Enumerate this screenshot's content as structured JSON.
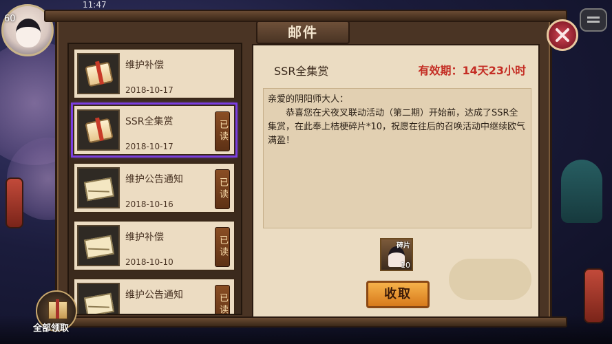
{
  "status_bar": {
    "time": "11:47"
  },
  "player": {
    "level": "60"
  },
  "window": {
    "title": "邮件"
  },
  "mail_list": [
    {
      "title": "维护补偿",
      "date": "2018-10-17",
      "icon": "gift-icon",
      "read_label": "",
      "selected": false
    },
    {
      "title": "SSR全集赏",
      "date": "2018-10-17",
      "icon": "gift-icon",
      "read_label": "已读",
      "selected": true
    },
    {
      "title": "维护公告通知",
      "date": "2018-10-16",
      "icon": "envelope-icon",
      "read_label": "已读",
      "selected": false
    },
    {
      "title": "维护补偿",
      "date": "2018-10-10",
      "icon": "envelope-icon",
      "read_label": "已读",
      "selected": false
    },
    {
      "title": "维护公告通知",
      "date": "",
      "icon": "envelope-icon",
      "read_label": "已读",
      "selected": false
    }
  ],
  "detail": {
    "title": "SSR全集赏",
    "expiry": "有效期：14天23小时",
    "greeting": "亲爱的阴阳师大人：",
    "body": "恭喜您在犬夜叉联动活动（第二期）开始前，达成了SSR全集赏，在此奉上桔梗碎片*10，祝愿在往后的召唤活动中继续欧气满盈！",
    "reward": {
      "label": "碎片",
      "count": "10"
    },
    "claim_label": "收取"
  },
  "claim_all_label": "全部领取",
  "colors": {
    "expiry": "#c42d24",
    "selected_outline": "#7a3ee0",
    "claim_button": "#e89330"
  }
}
